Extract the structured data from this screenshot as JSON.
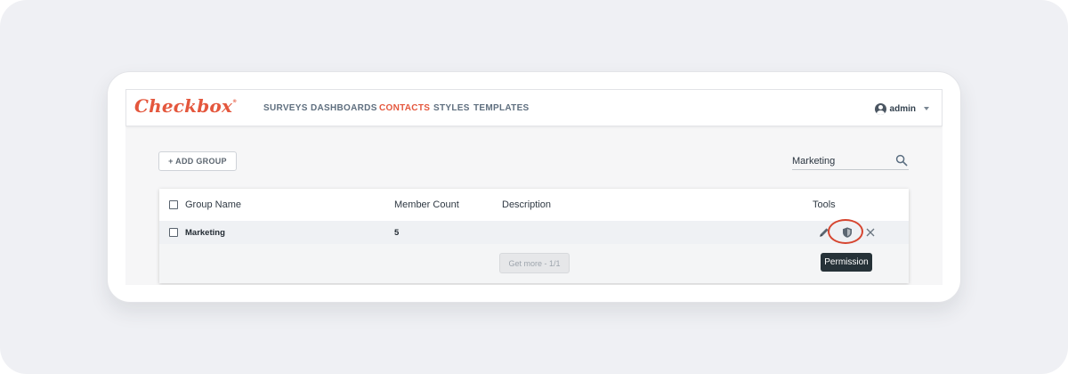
{
  "app": {
    "logo": "Checkbox",
    "logo_mark": "®"
  },
  "nav": {
    "items": [
      {
        "label": "SURVEYS"
      },
      {
        "label": "DASHBOARDS"
      },
      {
        "label": "CONTACTS",
        "active": true
      },
      {
        "label": "STYLES"
      },
      {
        "label": "TEMPLATES"
      }
    ]
  },
  "user": {
    "name": "admin"
  },
  "toolbar": {
    "add_group_label": "+ ADD GROUP"
  },
  "search": {
    "value": "Marketing",
    "placeholder": "",
    "icon": "search-icon"
  },
  "table": {
    "columns": [
      "Group Name",
      "Member Count",
      "Description",
      "Tools"
    ],
    "rows": [
      {
        "group_name": "Marketing",
        "member_count": "5",
        "description": ""
      }
    ],
    "get_more_label": "Get more - 1/1",
    "tools": [
      "pencil-icon",
      "shield-icon",
      "close-icon"
    ]
  },
  "tooltip": {
    "text": "Permission"
  },
  "colors": {
    "brand": "#e4573d",
    "nav_text": "#5f6f7f",
    "highlight": "#d6452f",
    "tooltip_bg": "#263238"
  }
}
